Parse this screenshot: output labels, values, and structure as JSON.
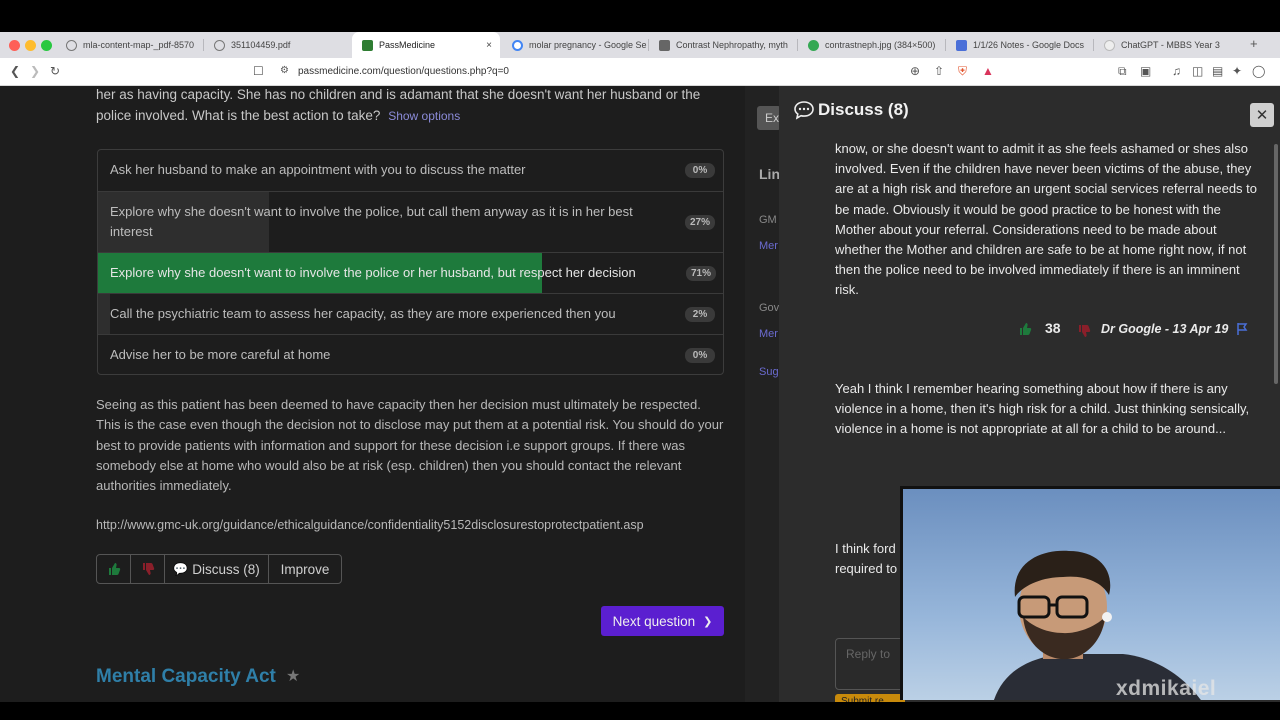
{
  "browser": {
    "tabs": [
      {
        "label": "mla-content-map-_pdf-8570",
        "favicon_color": "#888888"
      },
      {
        "label": "351104459.pdf",
        "favicon_color": "#888888"
      },
      {
        "label": "PassMedicine",
        "favicon_color": "#2e7d32",
        "active": true
      },
      {
        "label": "molar pregnancy - Google Se",
        "favicon_color": "#4285f4"
      },
      {
        "label": "Contrast Nephropathy, myth",
        "favicon_color": "#555555"
      },
      {
        "label": "contrastneph.jpg (384×500)",
        "favicon_color": "#34a853"
      },
      {
        "label": "1/1/26 Notes - Google Docs",
        "favicon_color": "#4a6fd8"
      },
      {
        "label": "ChatGPT - MBBS Year 3",
        "favicon_color": "#dddddd"
      }
    ],
    "close_glyph": "×",
    "new_tab_glyph": "+",
    "url": "passmedicine.com/question/questions.php?q=0"
  },
  "question": {
    "text_tail": "her as having capacity. She has no children and is adamant that she doesn't want her husband or the police involved. What is the best action to take?",
    "show_options": "Show options"
  },
  "answers": [
    {
      "text": "Ask her husband to make an appointment with you to discuss the matter",
      "percent": "0%",
      "fraction": 0.0
    },
    {
      "text": "Explore why she doesn't want to involve the police, but call them anyway as it is in her best interest",
      "percent": "27%",
      "fraction": 0.27
    },
    {
      "text": "Explore why she doesn't want to involve the police or her husband, but respect her decision",
      "percent": "71%",
      "fraction": 0.71,
      "correct": true
    },
    {
      "text": "Call the psychiatric team to assess her capacity, as they are more experienced then you",
      "percent": "2%",
      "fraction": 0.02
    },
    {
      "text": "Advise her to be more careful at home",
      "percent": "0%",
      "fraction": 0.0
    }
  ],
  "explanation": "Seeing as this patient has been deemed to have capacity then her decision must ultimately be respected. This is the case even though the decision not to disclose may put them at a potential risk. You should do your best to provide patients with information and support for these decision i.e support groups. If there was somebody else at home who would also be at risk (esp. children) then you should contact the relevant authorities immediately.",
  "reference_link": "http://www.gmc-uk.org/guidance/ethicalguidance/confidentiality5152disclosurestoprotectpatient.asp",
  "actions": {
    "discuss": "Discuss (8)",
    "improve": "Improve",
    "next": "Next question"
  },
  "section_title": "Mental Capacity Act",
  "side_column": {
    "tab_fragment": "Ex",
    "heading_fragment": "Lin",
    "item1": "GM",
    "item1_link": "Mer",
    "item2": "Gov",
    "item2_link": "Mer",
    "item3": "Sug"
  },
  "discuss_panel": {
    "title": "Discuss (8)",
    "close_glyph": "✕",
    "comments": [
      {
        "text": "know, or she doesn't want to admit it as she feels ashamed or shes also involved. Even if the children have never been victims of the abuse, they are at a high risk and therefore an urgent social services referral needs to be made. Obviously it would be good practice to be honest with the Mother about your referral. Considerations need to be made about whether the Mother and children are safe to be at home right now, if not then the police need to be involved immediately if there is an imminent risk.",
        "score": "38",
        "author": "Dr Google - 13 Apr 19"
      },
      {
        "text": "Yeah I think I remember hearing something about how if there is any violence in a home, then it's high risk for a child. Just thinking sensically, violence in a home is not appropriate at all for a child to be around...",
        "score": "",
        "author": ""
      },
      {
        "text": "I think ford\nrequired to",
        "score": "",
        "author": ""
      }
    ],
    "reply_placeholder": "Reply to",
    "submit_label": "Submit re..."
  },
  "watermark": "xdmikaiel",
  "colors": {
    "correct_fill": "#1e7a3c",
    "partial_fill": "#2f2f2f",
    "next_button": "#5b1fd0",
    "section_title": "#2f7fa8"
  }
}
